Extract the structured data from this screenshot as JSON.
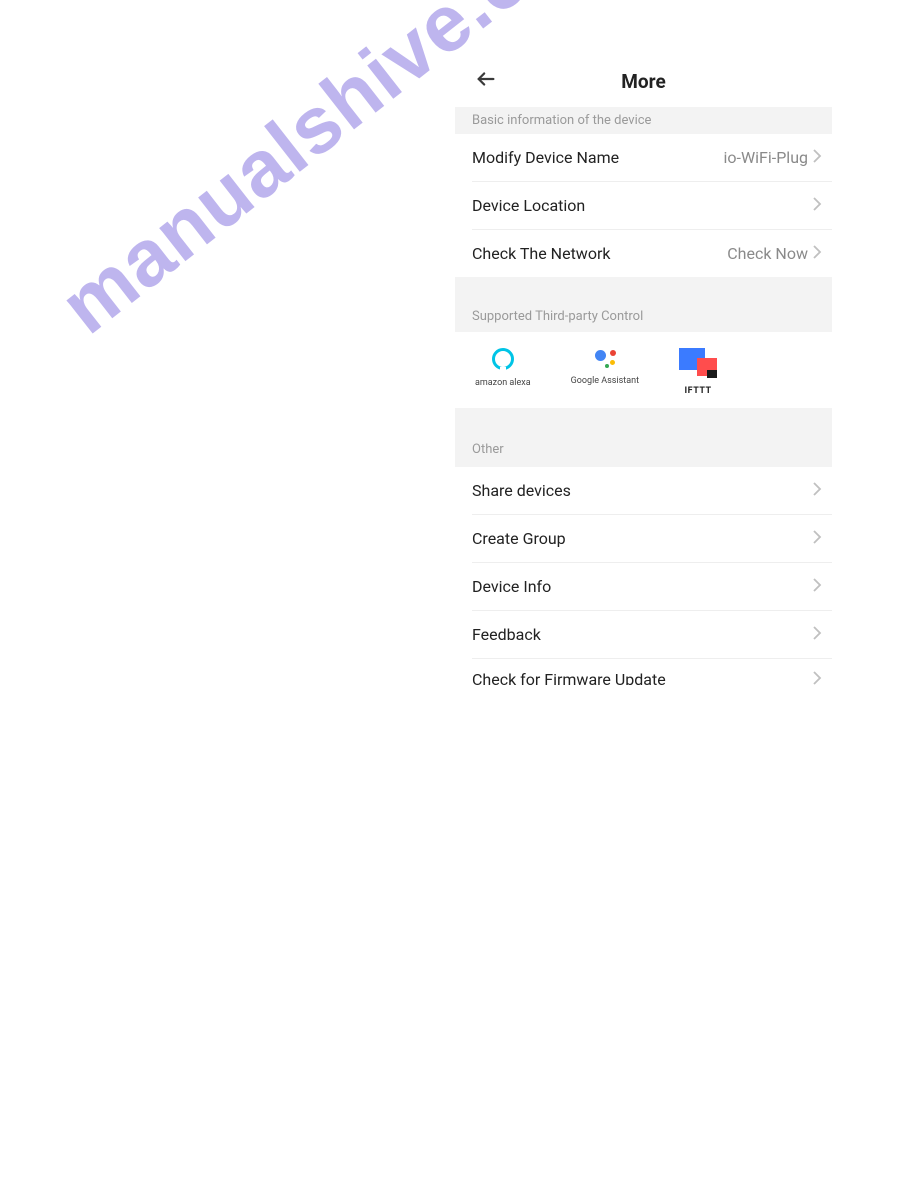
{
  "header": {
    "title": "More"
  },
  "sections": {
    "basic_info": {
      "header": "Basic information of the device",
      "items": [
        {
          "label": "Modify Device Name",
          "value": "io-WiFi-Plug"
        },
        {
          "label": "Device Location",
          "value": ""
        },
        {
          "label": "Check The Network",
          "value": "Check Now"
        }
      ]
    },
    "third_party": {
      "header": "Supported Third-party Control",
      "providers": [
        {
          "name": "amazon alexa"
        },
        {
          "name": "Google Assistant"
        },
        {
          "name": "IFTTT"
        }
      ]
    },
    "other": {
      "header": "Other",
      "items": [
        {
          "label": "Share devices"
        },
        {
          "label": "Create Group"
        },
        {
          "label": "Device Info"
        },
        {
          "label": "Feedback"
        },
        {
          "label": "Check for Firmware Update"
        }
      ]
    }
  },
  "watermark": "manualshive.com"
}
